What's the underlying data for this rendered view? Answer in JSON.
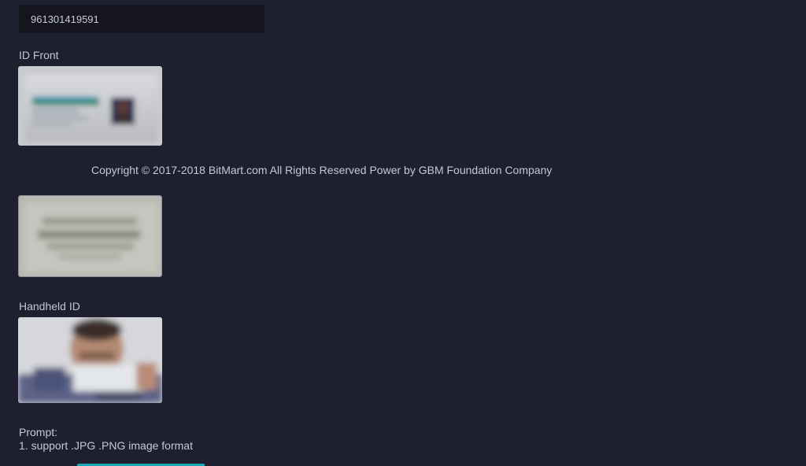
{
  "id_number": {
    "value": "961301419591"
  },
  "id_front": {
    "label": "ID Front"
  },
  "id_back": {
    "label": ""
  },
  "handheld_id": {
    "label": "Handheld ID"
  },
  "footer": {
    "copyright": "Copyright © 2017-2018 BitMart.com All Rights Reserved Power by GBM Foundation Company"
  },
  "prompt": {
    "title": "Prompt:",
    "items": [
      "1. support .JPG .PNG image format"
    ]
  },
  "colors": {
    "background": "#1e2030",
    "input_background": "#14151d",
    "accent": "#1aa9b8"
  }
}
